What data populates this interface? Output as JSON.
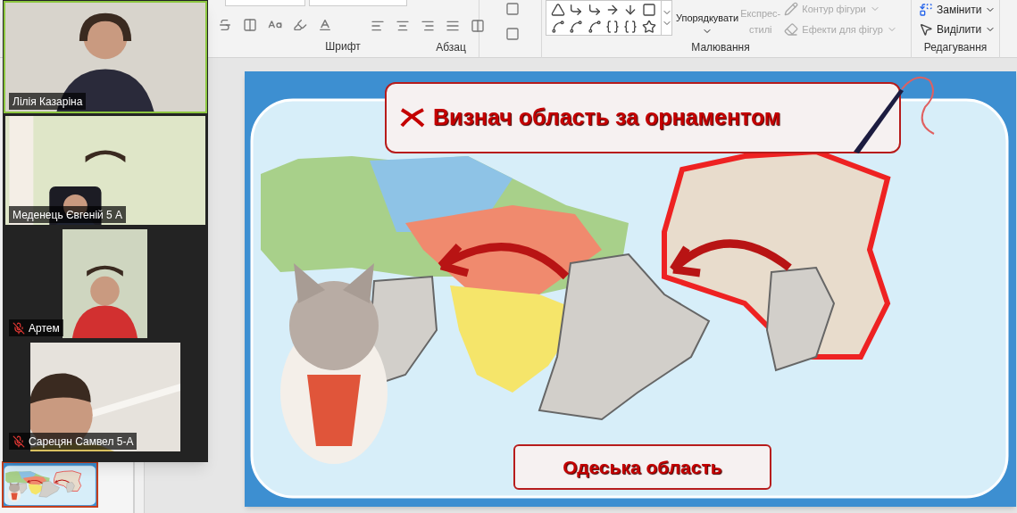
{
  "ribbon": {
    "groups": [
      {
        "label": "Шрифт"
      },
      {
        "label": "Абзац"
      },
      {
        "label": "Малювання"
      },
      {
        "label": "Редагування"
      }
    ],
    "drawing_buttons": [
      {
        "label": "Упорядкувати",
        "disabled": false
      },
      {
        "label": "Експрес-",
        "label_2": "стилі",
        "disabled": true
      }
    ],
    "format_buttons": [
      {
        "label": "Контур фігури",
        "disabled": true
      },
      {
        "label": "Ефекти для фігур",
        "disabled": true
      }
    ],
    "editing_buttons": [
      {
        "label": "Замінити",
        "disabled": false
      },
      {
        "label": "Виділити",
        "disabled": false
      }
    ]
  },
  "participants": [
    {
      "name": "Лілія Казаріна",
      "speaking": true,
      "muted": false
    },
    {
      "name": "Меденець Євгеній 5 А",
      "speaking": false,
      "muted": false
    },
    {
      "name": "Артем",
      "speaking": false,
      "muted": true
    },
    {
      "name": "Сарецян Самвел 5-А",
      "speaking": false,
      "muted": true
    }
  ],
  "slide": {
    "title": "Визнач область за орнаментом",
    "answer": "Одеська область"
  }
}
